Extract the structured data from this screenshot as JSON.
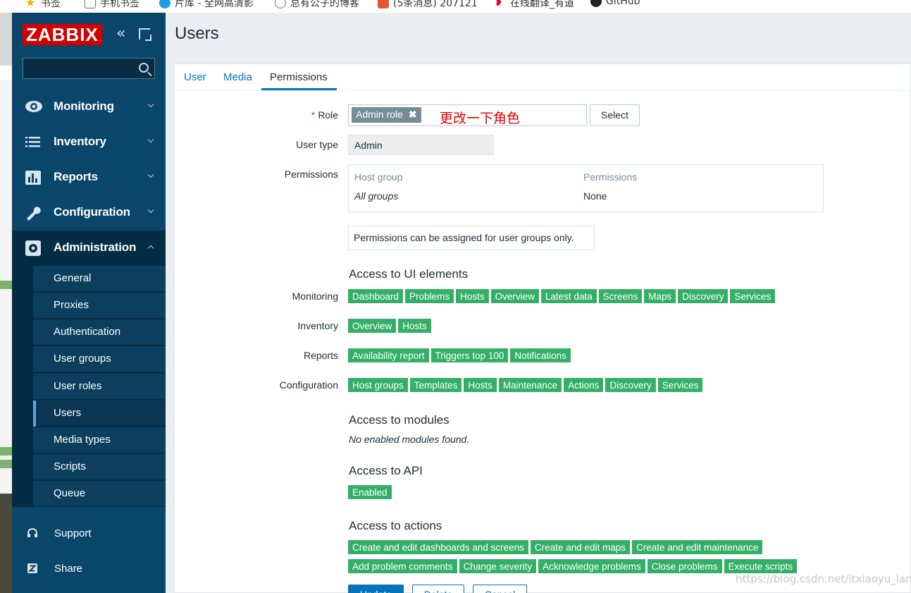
{
  "bookmarks": [
    {
      "label": "书签",
      "icon": "star-icon",
      "color": "#f2a900"
    },
    {
      "label": "手机书签",
      "icon": "mobile-icon",
      "color": "#777777"
    },
    {
      "label": "片库 - 全网高清影",
      "icon": "site-icon",
      "color": "#1e9be8"
    },
    {
      "label": "总有公子的博客",
      "icon": "globe-icon",
      "color": "#777777"
    },
    {
      "label": "(5条消息) 207121",
      "icon": "csdn-icon",
      "color": "#e4572e"
    },
    {
      "label": "在线翻译_有道",
      "icon": "youdao-icon",
      "color": "#e4002b"
    },
    {
      "label": "GitHub",
      "icon": "github-icon",
      "color": "#222222"
    }
  ],
  "sidebar": {
    "logo": "ZABBIX",
    "collapse_icon": "«",
    "menu": [
      {
        "label": "Monitoring",
        "icon": "eye-icon"
      },
      {
        "label": "Inventory",
        "icon": "list-icon"
      },
      {
        "label": "Reports",
        "icon": "bar-chart-icon"
      },
      {
        "label": "Configuration",
        "icon": "wrench-icon"
      },
      {
        "label": "Administration",
        "icon": "gear-icon"
      }
    ],
    "submenu": [
      "General",
      "Proxies",
      "Authentication",
      "User groups",
      "User roles",
      "Users",
      "Media types",
      "Scripts",
      "Queue"
    ],
    "active_submenu": "Users",
    "footer": [
      {
        "label": "Support",
        "icon": "headset-icon"
      },
      {
        "label": "Share",
        "icon": "share-z-icon"
      }
    ]
  },
  "page": {
    "title": "Users",
    "tabs": [
      "User",
      "Media",
      "Permissions"
    ],
    "active_tab": "Permissions"
  },
  "form": {
    "role_label": "Role",
    "required_mark": "*",
    "role_value": "Admin role",
    "role_remove": "✖",
    "annotation": "更改一下角色",
    "select_button": "Select",
    "user_type_label": "User type",
    "user_type_value": "Admin",
    "permissions_label": "Permissions",
    "perm_headers": [
      "Host group",
      "Permissions"
    ],
    "perm_row": [
      "All groups",
      "None"
    ],
    "perm_note": "Permissions can be assigned for user groups only."
  },
  "ui_access": {
    "title": "Access to UI elements",
    "monitoring_label": "Monitoring",
    "monitoring": [
      "Dashboard",
      "Problems",
      "Hosts",
      "Overview",
      "Latest data",
      "Screens",
      "Maps",
      "Discovery",
      "Services"
    ],
    "inventory_label": "Inventory",
    "inventory": [
      "Overview",
      "Hosts"
    ],
    "reports_label": "Reports",
    "reports": [
      "Availability report",
      "Triggers top 100",
      "Notifications"
    ],
    "configuration_label": "Configuration",
    "configuration": [
      "Host groups",
      "Templates",
      "Hosts",
      "Maintenance",
      "Actions",
      "Discovery",
      "Services"
    ]
  },
  "modules": {
    "title": "Access to modules",
    "text": "No enabled modules found."
  },
  "api": {
    "title": "Access to API",
    "status": "Enabled"
  },
  "actions": {
    "title": "Access to actions",
    "row1": [
      "Create and edit dashboards and screens",
      "Create and edit maps",
      "Create and edit maintenance"
    ],
    "row2": [
      "Add problem comments",
      "Change severity",
      "Acknowledge problems",
      "Close problems",
      "Execute scripts"
    ]
  },
  "buttons": {
    "update": "Update",
    "delete": "Delete",
    "cancel": "Cancel"
  },
  "watermark": "https://blog.csdn.net/itxiaoyu_lang",
  "colors": {
    "sidebar": "#0a466a",
    "accent": "#0275b8",
    "tag": "#34af67",
    "logo": "#d40000"
  }
}
